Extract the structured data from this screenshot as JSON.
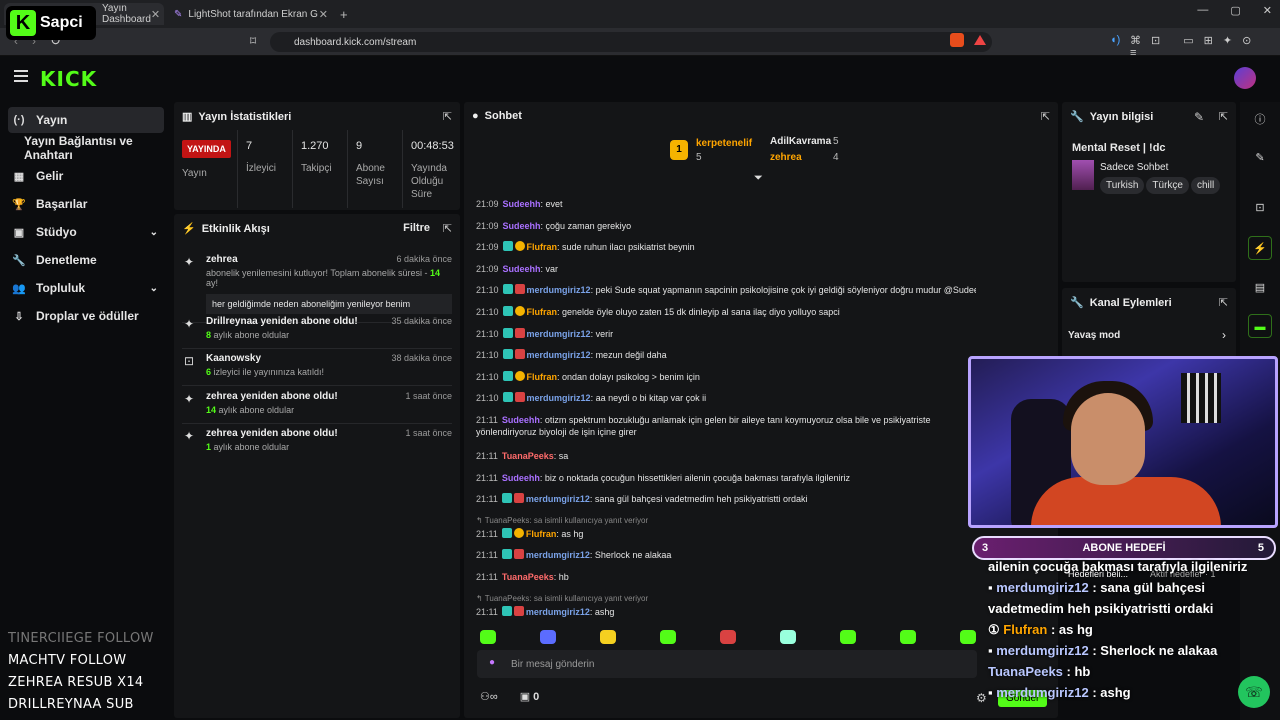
{
  "browser": {
    "tabs": [
      {
        "label": "Yayın Dashboard"
      },
      {
        "label": "LightShot tarafından Ekran Görüntüsü"
      }
    ],
    "url": "dashboard.kick.com/stream",
    "new_tab": "+",
    "win": [
      "—",
      "▢",
      "✕"
    ]
  },
  "overlay_logo": {
    "letter": "K",
    "name": "Sapci"
  },
  "header": {
    "logo": "KICK"
  },
  "sidebar": {
    "items": [
      {
        "label": "Yayın",
        "icon": "(·)"
      },
      {
        "label": "Yayın Bağlantısı ve Anahtarı"
      },
      {
        "label": "Gelir",
        "icon": "▦"
      },
      {
        "label": "Başarılar",
        "icon": "🏆"
      },
      {
        "label": "Stüdyo",
        "icon": "▣"
      },
      {
        "label": "Denetleme",
        "icon": "🔧"
      },
      {
        "label": "Topluluk",
        "icon": "👥"
      },
      {
        "label": "Droplar ve ödüller",
        "icon": "⇩"
      }
    ]
  },
  "overlay_follows": [
    "TINERCIIEGE  FOLLOW",
    "MACHTV  FOLLOW",
    "ZEHREA  RESUB X14",
    "DRILLREYNAA  SUB"
  ],
  "stats": {
    "title": "Yayın İstatistikleri",
    "live_badge": "YAYINDA",
    "live_label": "Yayın",
    "items": [
      {
        "value": "7",
        "label": "İzleyici"
      },
      {
        "value": "1.270",
        "label": "Takipçi"
      },
      {
        "value": "9",
        "label": "Abone Sayısı"
      },
      {
        "value": "00:48:53",
        "label": "Yayında Olduğu Süre"
      }
    ]
  },
  "activity": {
    "title": "Etkinlik Akışı",
    "filter": "Filtre",
    "items": [
      {
        "who": "zehrea",
        "when": "6 dakika önce",
        "sub": "abonelik yenilemesini kutluyor! Toplam abonelik süresi - ",
        "sub_num": "14",
        "sub_end": " ay!",
        "box": "her geldiğimde neden aboneliğim yenileyor benim"
      },
      {
        "who": "Drillreynaa yeniden abone oldu!",
        "when": "35 dakika önce",
        "num": "8",
        "sub": " aylık abone oldular"
      },
      {
        "who": "Kaanowsky",
        "when": "38 dakika önce",
        "num": "6",
        "sub": " izleyici ile yayınınıza katıldı!"
      },
      {
        "who": "zehrea yeniden abone oldu!",
        "when": "1 saat önce",
        "num": "14",
        "sub": " aylık abone oldular"
      },
      {
        "who": "zehrea yeniden abone oldu!",
        "when": "1 saat önce",
        "num": "1",
        "sub": " aylık abone oldular"
      }
    ]
  },
  "chat": {
    "title": "Sohbet",
    "pinned": [
      {
        "rank": "1",
        "name": "kerpetenelif",
        "count": "5"
      },
      {
        "name": "AdilKavrama",
        "count": "5"
      },
      {
        "name": "zehrea",
        "count": "4"
      }
    ],
    "messages": [
      {
        "time": "21:09",
        "user": "Sudeehh",
        "c": "purple",
        "text": ": evet"
      },
      {
        "time": "21:09",
        "user": "Sudeehh",
        "c": "purple",
        "text": ": çoğu zaman gerekiyo"
      },
      {
        "time": "21:09",
        "user": "Flufran",
        "c": "orange",
        "b": "b1b3",
        "text": ": sude ruhun ilacı psikiatrist beynin"
      },
      {
        "time": "21:09",
        "user": "Sudeehh",
        "c": "purple",
        "text": ": var"
      },
      {
        "time": "21:10",
        "user": "merdumgiriz12",
        "c": "blue",
        "b": "b1b2",
        "text": ": peki Sude squat yapmanın sapcinin psikolojisine çok iyi geldiği söyleniyor doğru mudur @Sudeehh"
      },
      {
        "time": "21:10",
        "user": "Flufran",
        "c": "orange",
        "b": "b1b3",
        "text": ": genelde öyle oluyo zaten 15 dk dinleyip al sana ilaç diyo yolluyo sapci"
      },
      {
        "time": "21:10",
        "user": "merdumgiriz12",
        "c": "blue",
        "b": "b1b2",
        "text": ": verir"
      },
      {
        "time": "21:10",
        "user": "merdumgiriz12",
        "c": "blue",
        "b": "b1b2",
        "text": ": mezun değil daha"
      },
      {
        "time": "21:10",
        "user": "Flufran",
        "c": "orange",
        "b": "b1b3",
        "text": ": ondan dolayı psikolog > benim için"
      },
      {
        "time": "21:10",
        "user": "merdumgiriz12",
        "c": "blue",
        "b": "b1b2",
        "text": ": aa neydi o bi kitap var çok ii"
      },
      {
        "time": "21:11",
        "user": "Sudeehh",
        "c": "purple",
        "two": true,
        "text": ": otizm spektrum bozukluğu anlamak için gelen bir aileye tanı koymuyoruz olsa bile ve psikiyatriste yönlendiriyoruz biyoloji de işin içine girer"
      },
      {
        "time": "21:11",
        "user": "TuanaPeeks",
        "c": "red",
        "text": ": sa"
      },
      {
        "time": "21:11",
        "user": "Sudeehh",
        "c": "purple",
        "text": ": biz o noktada çocuğun hissettikleri ailenin çocuğa bakması tarafıyla ilgileniriz"
      },
      {
        "time": "21:11",
        "user": "merdumgiriz12",
        "c": "blue",
        "b": "b1b2",
        "text": ": sana gül bahçesi vadetmedim heh psikiyatristti ordaki"
      },
      {
        "reply": "↰ TuanaPeeks: sa isimli kullanıcıya yanıt veriyor"
      },
      {
        "time": "21:11",
        "user": "Flufran",
        "c": "orange",
        "b": "b1b3",
        "text": ": as hg"
      },
      {
        "time": "21:11",
        "user": "merdumgiriz12",
        "c": "blue",
        "b": "b1b2",
        "text": ": Sherlock ne alakaa"
      },
      {
        "time": "21:11",
        "user": "TuanaPeeks",
        "c": "red",
        "text": ": hb"
      },
      {
        "reply": "↰ TuanaPeeks: sa isimli kullanıcıya yanıt veriyor"
      },
      {
        "time": "21:11",
        "user": "merdumgiriz12",
        "c": "blue",
        "b": "b1b2",
        "text": ": ashg"
      }
    ],
    "input_placeholder": "Bir mesaj gönderin",
    "footer_count": "0",
    "send": "Gönder"
  },
  "stream_info": {
    "title": "Yayın bilgisi",
    "stream_title": "Mental Reset | !dc",
    "category": "Sadece Sohbet",
    "tags": [
      "Turkish",
      "Türkçe",
      "chill"
    ]
  },
  "channel_actions": {
    "title": "Kanal Eylemleri",
    "slow_mode": "Yavaş mod"
  },
  "goal": {
    "left": "3",
    "label": "ABONE HEDEFİ",
    "right": "5",
    "sub": "Hedefleri beli...",
    "sub2": "Aktif hedefler · 1"
  },
  "overlay_chat": [
    {
      "user": "",
      "text": "ailenin çocuğa bakması tarafıyla ilgileniriz"
    },
    {
      "user": "merdumgiriz12",
      "text": " : sana gül bahçesi vadetmedim heh psikiyatristti ordaki"
    },
    {
      "user": "Flufran",
      "text": " : as hg"
    },
    {
      "user": "merdumgiriz12",
      "text": " : Sherlock ne alakaa"
    },
    {
      "user": "TuanaPeeks",
      "text": " : hb"
    },
    {
      "user": "merdumgiriz12",
      "text": " : ashg"
    }
  ],
  "colors": {
    "accent": "#53fc18",
    "live": "#c21414",
    "panel": "#141517"
  }
}
